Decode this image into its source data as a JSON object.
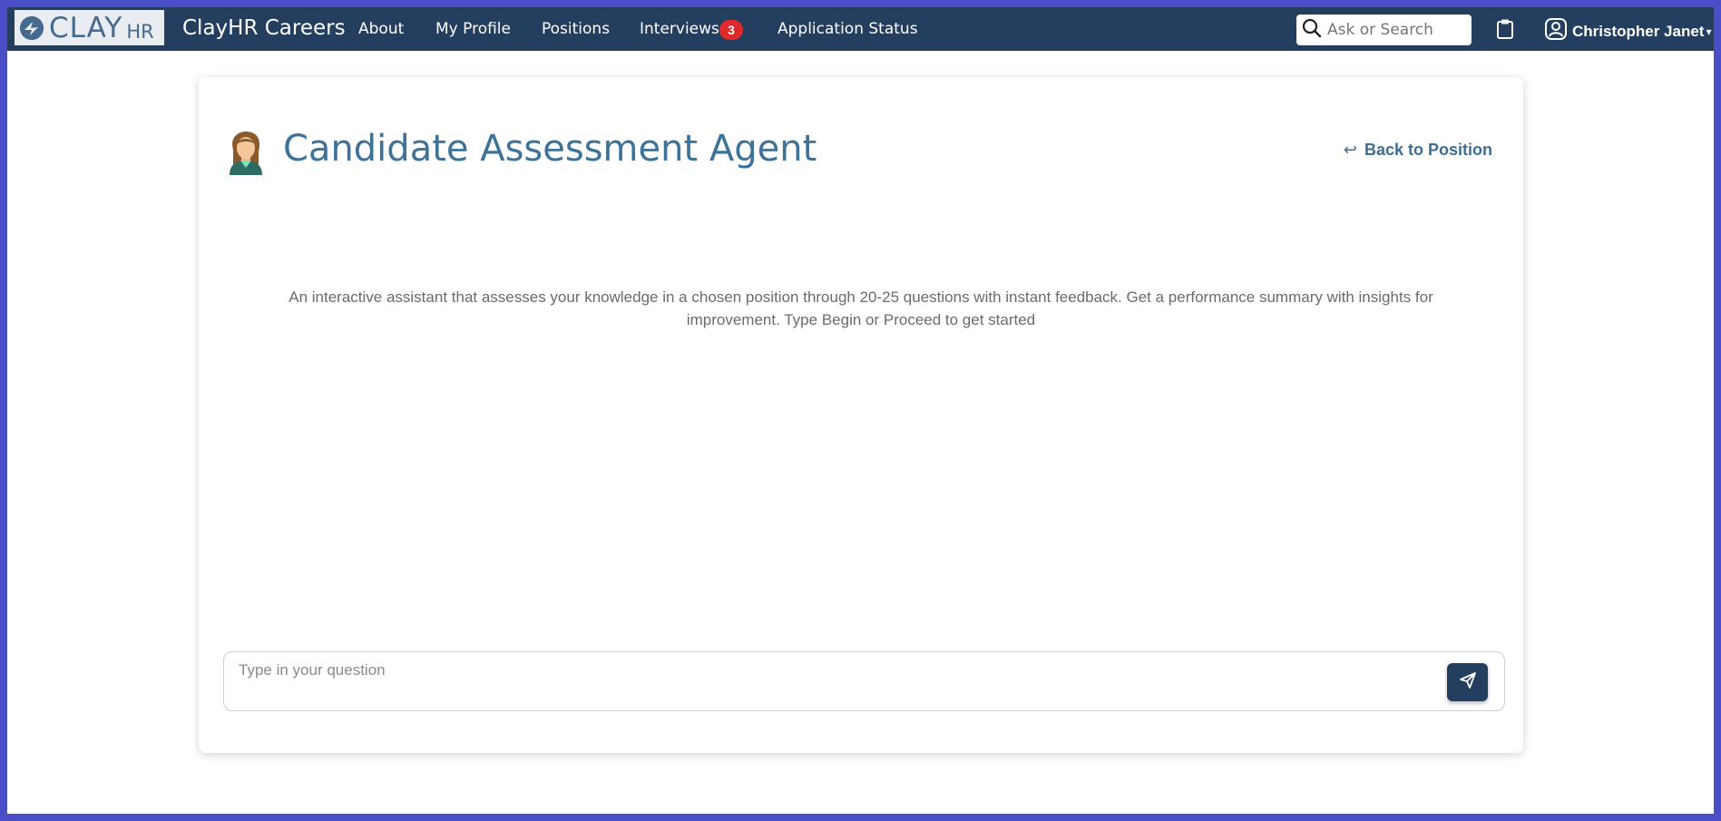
{
  "nav": {
    "logo_main": "CLAY",
    "logo_suffix": "HR",
    "brand": "ClayHR Careers",
    "links": [
      "About",
      "My Profile",
      "Positions",
      "Interviews",
      "Application Status"
    ],
    "interviews_badge": "3",
    "search_placeholder": "Ask or Search",
    "user_name": "Christopher Janet",
    "caret": "▾"
  },
  "page": {
    "title": "Candidate Assessment Agent",
    "back_label": "Back to Position",
    "back_arrow": "↩",
    "description_line1": "An interactive assistant that assesses your knowledge in a chosen position through 20-25 questions with instant feedback. Get a performance summary with insights for",
    "description_line2": "improvement. Type Begin or Proceed to get started",
    "input_placeholder": "Type in your question"
  },
  "colors": {
    "navbar": "#233e5e",
    "accent": "#3d7299",
    "badge": "#e02a2a",
    "frame": "#4a4fc9"
  },
  "icons": {
    "logo": "clayhr-logo-icon",
    "search": "search-icon",
    "clipboard": "clipboard-icon",
    "user": "user-avatar-icon",
    "agent": "agent-avatar-icon",
    "back": "back-arrow-icon",
    "send": "send-icon"
  }
}
